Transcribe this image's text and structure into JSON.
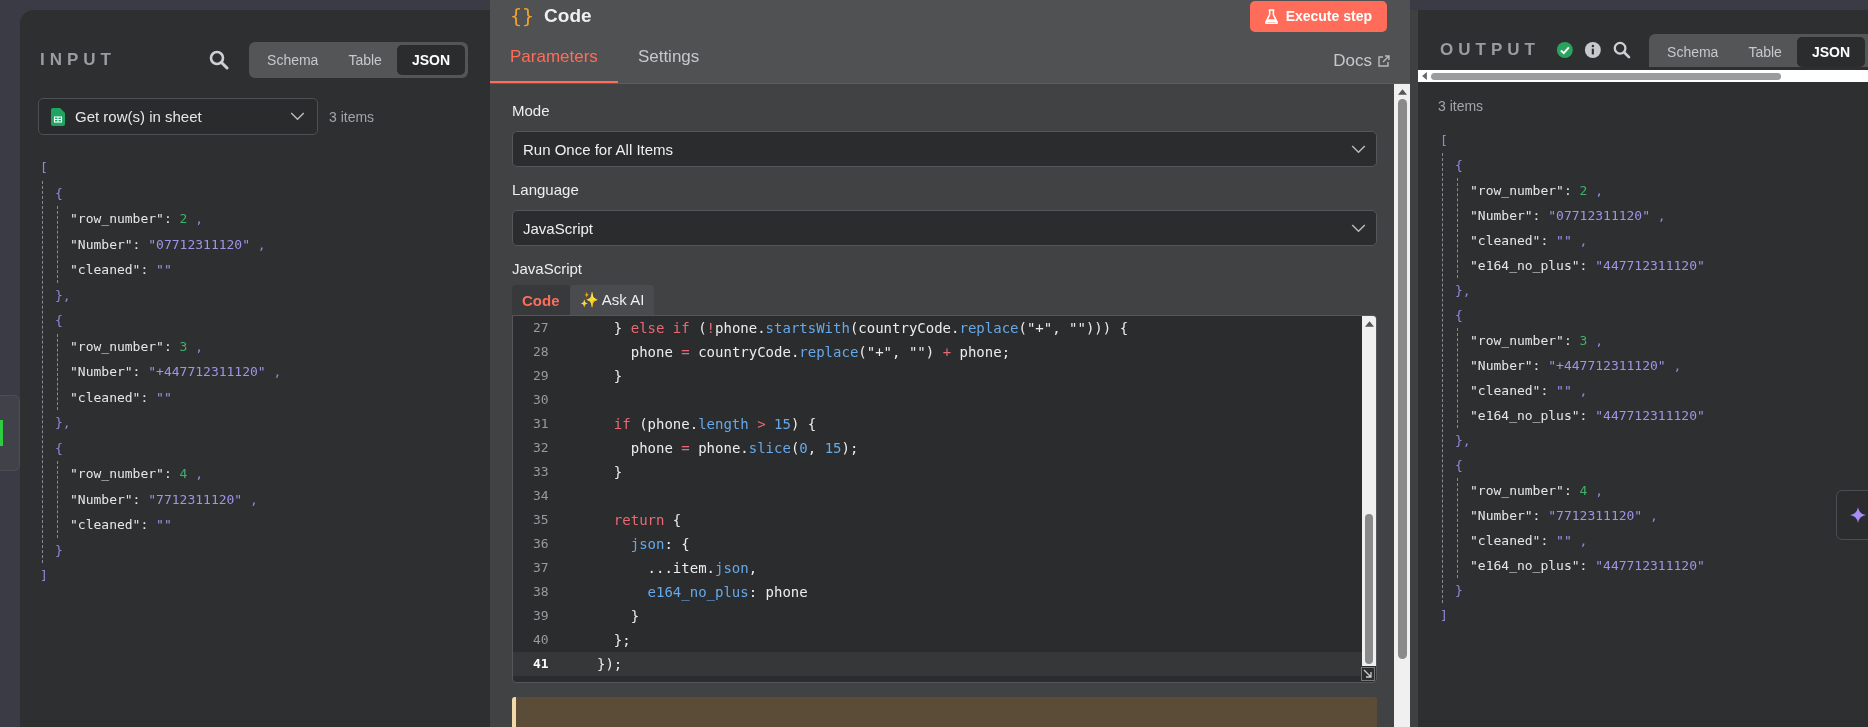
{
  "input": {
    "title": "INPUT",
    "views": [
      {
        "label": "Schema",
        "selected": false
      },
      {
        "label": "Table",
        "selected": false
      },
      {
        "label": "JSON",
        "selected": true
      }
    ],
    "source": "Get row(s) in sheet",
    "count": "3 items",
    "json": {
      "open": "[",
      "close": "]",
      "items": [
        {
          "open": "{",
          "close": "},",
          "fields": [
            {
              "key": "\"row_number\":",
              "value": "2",
              "kind": "number",
              "comma": ","
            },
            {
              "key": "\"Number\":",
              "value": "\"07712311120\"",
              "kind": "string",
              "comma": ","
            },
            {
              "key": "\"cleaned\":",
              "value": "\"\"",
              "kind": "string"
            }
          ]
        },
        {
          "open": "{",
          "close": "},",
          "fields": [
            {
              "key": "\"row_number\":",
              "value": "3",
              "kind": "number",
              "comma": ","
            },
            {
              "key": "\"Number\":",
              "value": "\"+447712311120\"",
              "kind": "string",
              "comma": ","
            },
            {
              "key": "\"cleaned\":",
              "value": "\"\"",
              "kind": "string"
            }
          ]
        },
        {
          "open": "{",
          "close": "}",
          "fields": [
            {
              "key": "\"row_number\":",
              "value": "4",
              "kind": "number",
              "comma": ","
            },
            {
              "key": "\"Number\":",
              "value": "\"7712311120\"",
              "kind": "string",
              "comma": ","
            },
            {
              "key": "\"cleaned\":",
              "value": "\"\"",
              "kind": "string"
            }
          ]
        }
      ]
    }
  },
  "node": {
    "icon": "{}",
    "title": "Code",
    "run_button": "Execute step",
    "tabs": [
      {
        "label": "Parameters",
        "selected": true
      },
      {
        "label": "Settings",
        "selected": false
      }
    ],
    "docs": "Docs",
    "fields": [
      {
        "label": "Mode",
        "value": "Run Once for All Items"
      },
      {
        "label": "Language",
        "value": "JavaScript"
      }
    ],
    "editor": {
      "label": "JavaScript",
      "tabs": [
        {
          "label": "Code",
          "selected": true
        },
        {
          "label": "✨ Ask AI",
          "selected": false
        }
      ],
      "lines": [
        {
          "n": "27",
          "active": false,
          "tokens": [
            {
              "t": "  } ",
              "kind": "plain"
            },
            {
              "t": "else if",
              "kind": "keyword"
            },
            {
              "t": " (",
              "kind": "plain"
            },
            {
              "t": "!",
              "kind": "operator"
            },
            {
              "t": "phone.",
              "kind": "plain"
            },
            {
              "t": "startsWith",
              "kind": "property"
            },
            {
              "t": "(countryCode.",
              "kind": "plain"
            },
            {
              "t": "replace",
              "kind": "property"
            },
            {
              "t": "(\"+\", \"\"))) {",
              "kind": "plain"
            }
          ]
        },
        {
          "n": "28",
          "active": false,
          "tokens": [
            {
              "t": "    phone ",
              "kind": "plain"
            },
            {
              "t": "=",
              "kind": "operator"
            },
            {
              "t": " countryCode.",
              "kind": "plain"
            },
            {
              "t": "replace",
              "kind": "property"
            },
            {
              "t": "(\"+\", \"\") ",
              "kind": "plain"
            },
            {
              "t": "+",
              "kind": "operator"
            },
            {
              "t": " phone;",
              "kind": "plain"
            }
          ]
        },
        {
          "n": "29",
          "active": false,
          "tokens": [
            {
              "t": "  }",
              "kind": "plain"
            }
          ]
        },
        {
          "n": "30",
          "active": false
        },
        {
          "n": "31",
          "active": false,
          "tokens": [
            {
              "t": "  if",
              "kind": "keyword"
            },
            {
              "t": " (phone.",
              "kind": "plain"
            },
            {
              "t": "length",
              "kind": "property"
            },
            {
              "t": " >",
              "kind": "operator"
            },
            {
              "t": " 15",
              "kind": "number"
            },
            {
              "t": ") {",
              "kind": "plain"
            }
          ]
        },
        {
          "n": "32",
          "active": false,
          "tokens": [
            {
              "t": "    phone ",
              "kind": "plain"
            },
            {
              "t": "=",
              "kind": "operator"
            },
            {
              "t": " phone.",
              "kind": "plain"
            },
            {
              "t": "slice",
              "kind": "property"
            },
            {
              "t": "(",
              "kind": "plain"
            },
            {
              "t": "0",
              "kind": "number"
            },
            {
              "t": ", ",
              "kind": "plain"
            },
            {
              "t": "15",
              "kind": "number"
            },
            {
              "t": ");",
              "kind": "plain"
            }
          ]
        },
        {
          "n": "33",
          "active": false,
          "tokens": [
            {
              "t": "  }",
              "kind": "plain"
            }
          ]
        },
        {
          "n": "34",
          "active": false
        },
        {
          "n": "35",
          "active": false,
          "tokens": [
            {
              "t": "  return",
              "kind": "keyword"
            },
            {
              "t": " {",
              "kind": "plain"
            }
          ]
        },
        {
          "n": "36",
          "active": false,
          "tokens": [
            {
              "t": "    json",
              "kind": "property"
            },
            {
              "t": ": {",
              "kind": "plain"
            }
          ]
        },
        {
          "n": "37",
          "active": false,
          "tokens": [
            {
              "t": "      ...item.",
              "kind": "plain"
            },
            {
              "t": "json",
              "kind": "property"
            },
            {
              "t": ",",
              "kind": "plain"
            }
          ]
        },
        {
          "n": "38",
          "active": false,
          "tokens": [
            {
              "t": "      e164_no_plus",
              "kind": "property"
            },
            {
              "t": ": phone",
              "kind": "plain"
            }
          ]
        },
        {
          "n": "39",
          "active": false,
          "tokens": [
            {
              "t": "    }",
              "kind": "plain"
            }
          ]
        },
        {
          "n": "40",
          "active": false,
          "tokens": [
            {
              "t": "  };",
              "kind": "plain"
            }
          ]
        },
        {
          "n": "41",
          "active": true,
          "tokens": [
            {
              "t": "});",
              "kind": "plain"
            }
          ]
        }
      ]
    }
  },
  "output": {
    "title": "OUTPUT",
    "views": [
      {
        "label": "Schema",
        "selected": false
      },
      {
        "label": "Table",
        "selected": false
      },
      {
        "label": "JSON",
        "selected": true
      }
    ],
    "count": "3 items",
    "json": {
      "open": "[",
      "close": "]",
      "items": [
        {
          "open": "{",
          "close": "},",
          "fields": [
            {
              "key": "\"row_number\":",
              "value": "2",
              "kind": "number",
              "comma": ","
            },
            {
              "key": "\"Number\":",
              "value": "\"07712311120\"",
              "kind": "string",
              "comma": ","
            },
            {
              "key": "\"cleaned\":",
              "value": "\"\"",
              "kind": "string",
              "comma": ","
            },
            {
              "key": "\"e164_no_plus\":",
              "value": "\"447712311120\"",
              "kind": "string"
            }
          ]
        },
        {
          "open": "{",
          "close": "},",
          "fields": [
            {
              "key": "\"row_number\":",
              "value": "3",
              "kind": "number",
              "comma": ","
            },
            {
              "key": "\"Number\":",
              "value": "\"+447712311120\"",
              "kind": "string",
              "comma": ","
            },
            {
              "key": "\"cleaned\":",
              "value": "\"\"",
              "kind": "string",
              "comma": ","
            },
            {
              "key": "\"e164_no_plus\":",
              "value": "\"447712311120\"",
              "kind": "string"
            }
          ]
        },
        {
          "open": "{",
          "close": "}",
          "fields": [
            {
              "key": "\"row_number\":",
              "value": "4",
              "kind": "number",
              "comma": ","
            },
            {
              "key": "\"Number\":",
              "value": "\"7712311120\"",
              "kind": "string",
              "comma": ","
            },
            {
              "key": "\"cleaned\":",
              "value": "\"\"",
              "kind": "string",
              "comma": ","
            },
            {
              "key": "\"e164_no_plus\":",
              "value": "\"447712311120\"",
              "kind": "string"
            }
          ]
        }
      ]
    }
  }
}
